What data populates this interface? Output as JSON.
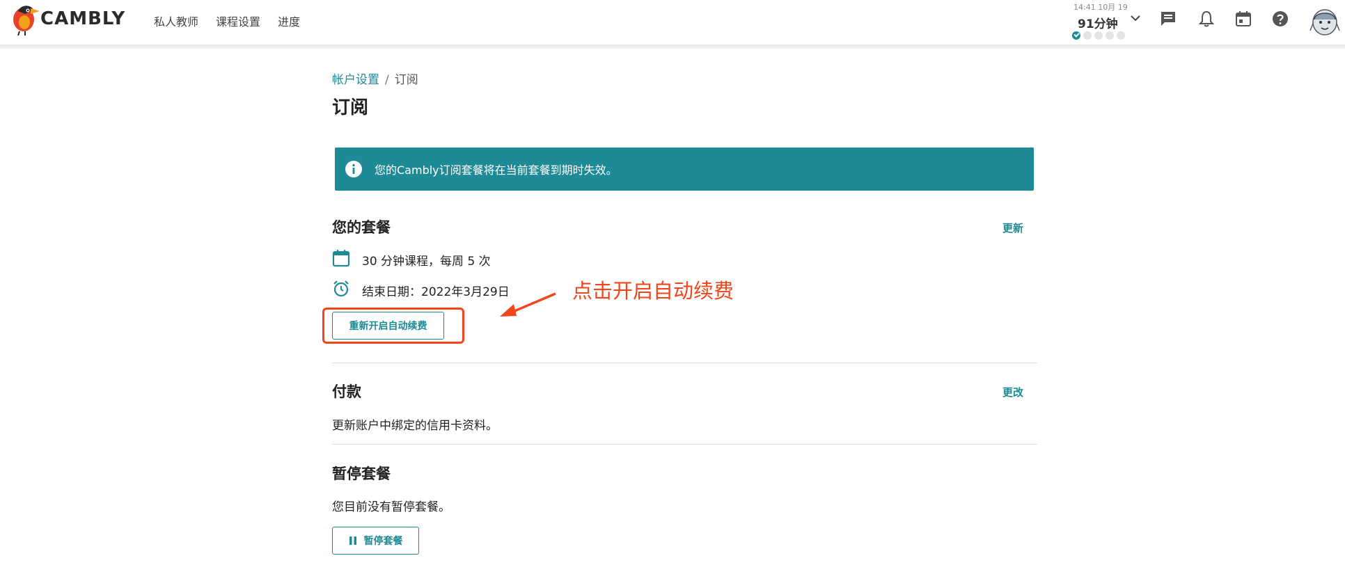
{
  "header": {
    "brand": "CAMBLY",
    "nav": [
      "私人教师",
      "课程设置",
      "进度"
    ],
    "minutes": {
      "timestamp": "14:41 10月 19",
      "label": "91分钟",
      "dots_total": 5,
      "dots_done": 1
    },
    "icons": [
      "chat-icon",
      "bell-icon",
      "calendar-icon",
      "help-icon"
    ]
  },
  "breadcrumb": {
    "parent": "帐户设置",
    "separator": "/",
    "current": "订阅"
  },
  "page_title": "订阅",
  "banner": {
    "text": "您的Cambly订阅套餐将在当前套餐到期时失效。"
  },
  "plan": {
    "title": "您的套餐",
    "action": "更新",
    "lesson_info": "30 分钟课程，每周 5 次",
    "end_date": "结束日期：2022年3月29日",
    "renew_button": "重新开启自动续费"
  },
  "annotation": {
    "text": "点击开启自动续费"
  },
  "payment": {
    "title": "付款",
    "action": "更改",
    "description": "更新账户中绑定的信用卡资料。"
  },
  "pause": {
    "title": "暂停套餐",
    "description": "您目前没有暂停套餐。",
    "button": "暂停套餐"
  },
  "colors": {
    "accent": "#1d8a95",
    "annotation": "#f0461c",
    "logo_red": "#e8412c",
    "logo_orange": "#f5a21b"
  }
}
